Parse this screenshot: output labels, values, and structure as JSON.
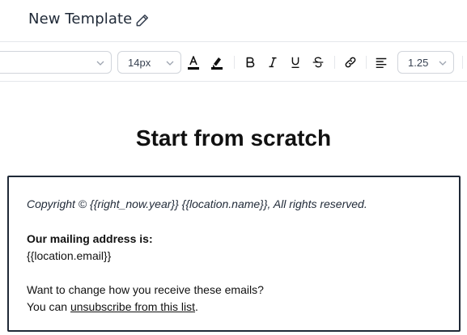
{
  "header": {
    "title": "New Template"
  },
  "toolbar": {
    "font_size": "14px",
    "line_height": "1.25",
    "text_color": "#000000",
    "highlight_color": "#000000"
  },
  "content": {
    "heading": "Start from scratch",
    "footer": {
      "copyright": "Copyright © {{right_now.year}}  {{location.name}}, All rights reserved.",
      "mailing_label": "Our mailing address is:",
      "mailing_value": "{{location.email}}",
      "change_question": "Want to change how you receive these emails?",
      "you_can": "You can ",
      "unsubscribe_link": "unsubscribe from this list",
      "period": "."
    }
  }
}
